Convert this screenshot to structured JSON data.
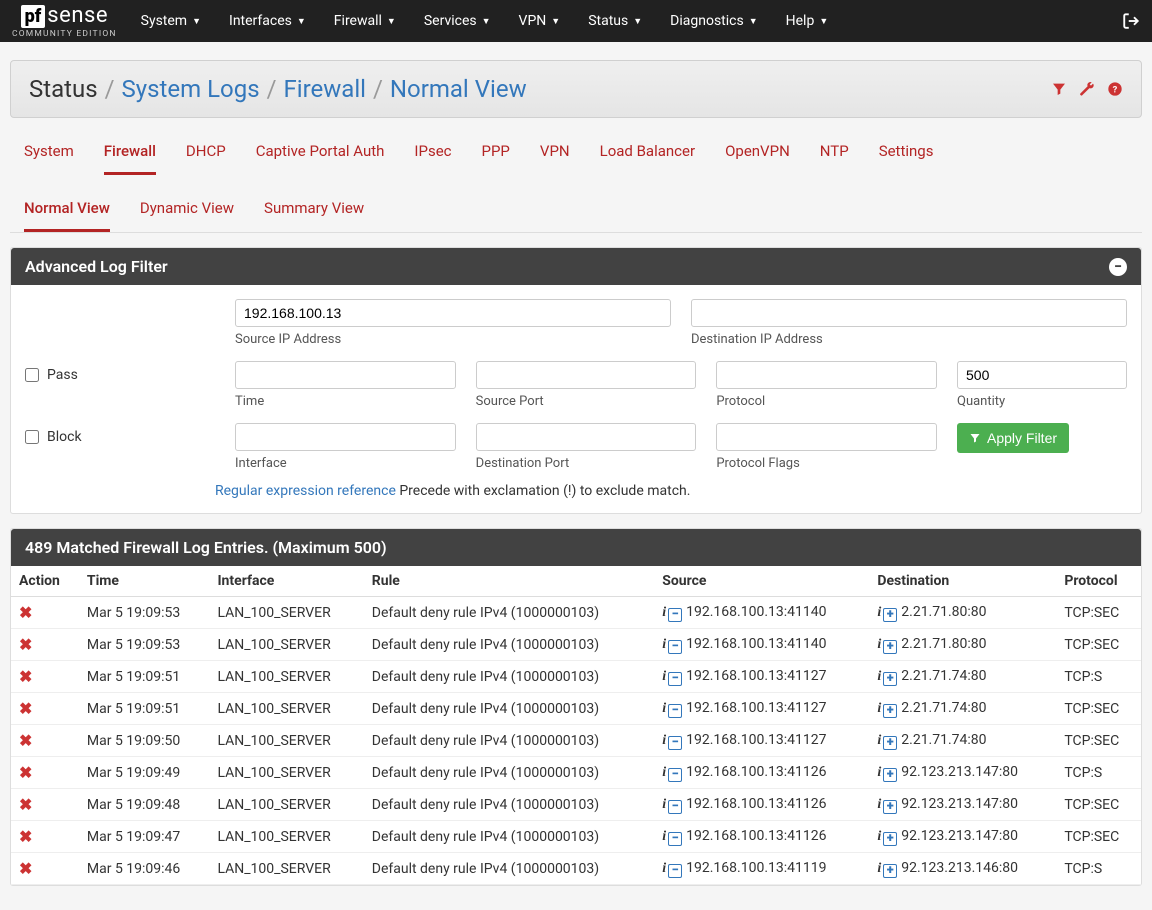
{
  "brand": {
    "box": "pf",
    "text": "sense",
    "edition": "COMMUNITY EDITION"
  },
  "navbar": {
    "items": [
      "System",
      "Interfaces",
      "Firewall",
      "Services",
      "VPN",
      "Status",
      "Diagnostics",
      "Help"
    ]
  },
  "breadcrumb": [
    "Status",
    "System Logs",
    "Firewall",
    "Normal View"
  ],
  "tabs1": [
    "System",
    "Firewall",
    "DHCP",
    "Captive Portal Auth",
    "IPsec",
    "PPP",
    "VPN",
    "Load Balancer",
    "OpenVPN",
    "NTP",
    "Settings"
  ],
  "tabs1_active": 1,
  "tabs2": [
    "Normal View",
    "Dynamic View",
    "Summary View"
  ],
  "tabs2_active": 0,
  "filter": {
    "title": "Advanced Log Filter",
    "source_ip_value": "192.168.100.13",
    "source_ip_label": "Source IP Address",
    "dest_ip_value": "",
    "dest_ip_label": "Destination IP Address",
    "pass_label": "Pass",
    "block_label": "Block",
    "time_label": "Time",
    "srcport_label": "Source Port",
    "protocol_label": "Protocol",
    "quantity_label": "Quantity",
    "quantity_value": "500",
    "interface_label": "Interface",
    "dstport_label": "Destination Port",
    "protoflags_label": "Protocol Flags",
    "apply_label": "Apply Filter",
    "hint_link": "Regular expression reference",
    "hint_tail": " Precede with exclamation (!) to exclude match."
  },
  "results": {
    "title": "489 Matched Firewall Log Entries. (Maximum 500)",
    "columns": [
      "Action",
      "Time",
      "Interface",
      "Rule",
      "Source",
      "Destination",
      "Protocol"
    ],
    "rows": [
      {
        "time": "Mar 5 19:09:53",
        "iface": "LAN_100_SERVER",
        "rule": "Default deny rule IPv4 (1000000103)",
        "src": "192.168.100.13:41140",
        "dst": "2.21.71.80:80",
        "proto": "TCP:SEC"
      },
      {
        "time": "Mar 5 19:09:53",
        "iface": "LAN_100_SERVER",
        "rule": "Default deny rule IPv4 (1000000103)",
        "src": "192.168.100.13:41140",
        "dst": "2.21.71.80:80",
        "proto": "TCP:SEC"
      },
      {
        "time": "Mar 5 19:09:51",
        "iface": "LAN_100_SERVER",
        "rule": "Default deny rule IPv4 (1000000103)",
        "src": "192.168.100.13:41127",
        "dst": "2.21.71.74:80",
        "proto": "TCP:S"
      },
      {
        "time": "Mar 5 19:09:51",
        "iface": "LAN_100_SERVER",
        "rule": "Default deny rule IPv4 (1000000103)",
        "src": "192.168.100.13:41127",
        "dst": "2.21.71.74:80",
        "proto": "TCP:SEC"
      },
      {
        "time": "Mar 5 19:09:50",
        "iface": "LAN_100_SERVER",
        "rule": "Default deny rule IPv4 (1000000103)",
        "src": "192.168.100.13:41127",
        "dst": "2.21.71.74:80",
        "proto": "TCP:SEC"
      },
      {
        "time": "Mar 5 19:09:49",
        "iface": "LAN_100_SERVER",
        "rule": "Default deny rule IPv4 (1000000103)",
        "src": "192.168.100.13:41126",
        "dst": "92.123.213.147:80",
        "proto": "TCP:S"
      },
      {
        "time": "Mar 5 19:09:48",
        "iface": "LAN_100_SERVER",
        "rule": "Default deny rule IPv4 (1000000103)",
        "src": "192.168.100.13:41126",
        "dst": "92.123.213.147:80",
        "proto": "TCP:SEC"
      },
      {
        "time": "Mar 5 19:09:47",
        "iface": "LAN_100_SERVER",
        "rule": "Default deny rule IPv4 (1000000103)",
        "src": "192.168.100.13:41126",
        "dst": "92.123.213.147:80",
        "proto": "TCP:SEC"
      },
      {
        "time": "Mar 5 19:09:46",
        "iface": "LAN_100_SERVER",
        "rule": "Default deny rule IPv4 (1000000103)",
        "src": "192.168.100.13:41119",
        "dst": "92.123.213.146:80",
        "proto": "TCP:S"
      }
    ]
  }
}
